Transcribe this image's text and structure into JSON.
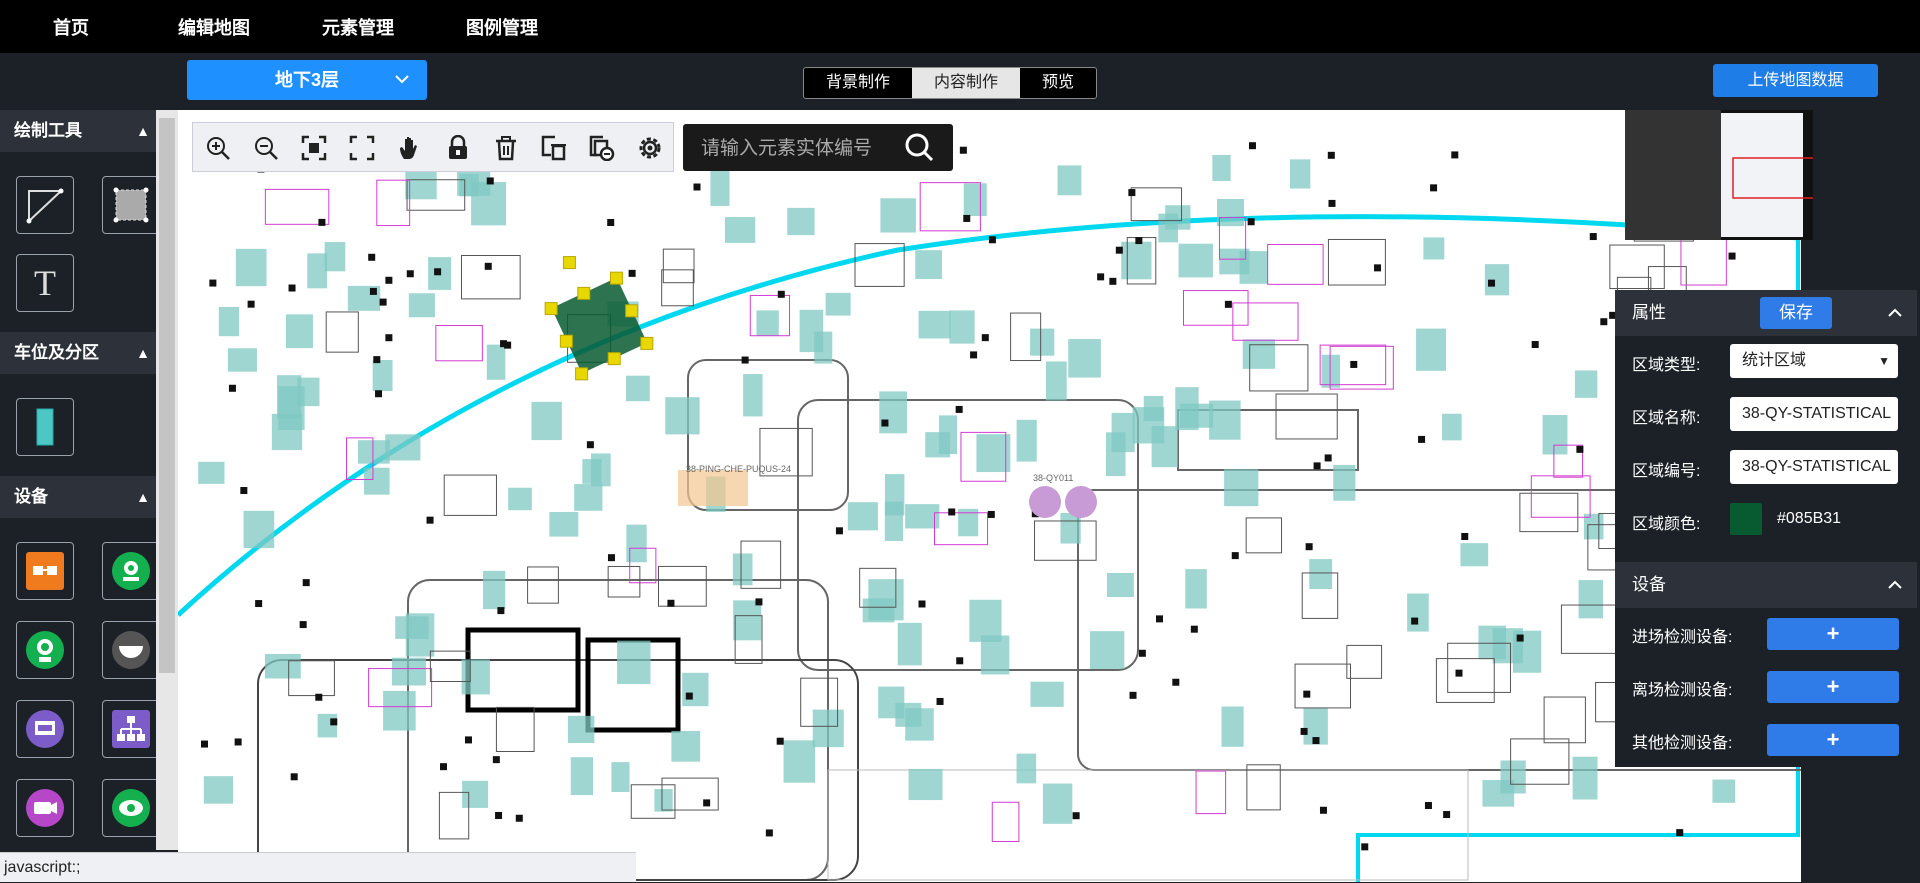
{
  "nav": {
    "items": [
      "首页",
      "编辑地图",
      "元素管理",
      "图例管理"
    ]
  },
  "floor": {
    "selected": "地下3层"
  },
  "modes": {
    "items": [
      "背景制作",
      "内容制作",
      "预览"
    ],
    "active": "内容制作"
  },
  "upload_label": "上传地图数据",
  "sidebar": {
    "draw_tools_title": "绘制工具",
    "parking_title": "车位及分区",
    "devices_title": "设备",
    "text_tool_glyph": "T"
  },
  "toolbar": {
    "icons": [
      "zoom-in-icon",
      "zoom-out-icon",
      "fit-screen-icon",
      "fullscreen-icon",
      "pan-hand-icon",
      "lock-icon",
      "delete-icon",
      "delete-layer-icon",
      "remove-layer-icon",
      "settings-icon"
    ]
  },
  "search": {
    "placeholder": "请输入元素实体编号"
  },
  "properties": {
    "title": "属性",
    "save_label": "保存",
    "area_type_label": "区域类型:",
    "area_type_value": "统计区域",
    "area_name_label": "区域名称:",
    "area_name_value": "38-QY-STATISTICAL",
    "area_code_label": "区域编号:",
    "area_code_value": "38-QY-STATISTICAL",
    "area_color_label": "区域颜色:",
    "area_color_value": "#085B31"
  },
  "devices": {
    "title": "设备",
    "entry_label": "进场检测设备:",
    "exit_label": "离场检测设备:",
    "other_label": "其他检测设备:",
    "plus": "+"
  },
  "map_labels": {
    "label_1": "38-PING-CHE-PUQUS-24",
    "label_2": "38-QY011"
  },
  "status_text": "javascript:;",
  "colors": {
    "accent": "#1e90ff",
    "selected_area": "#085B31",
    "parking": "#7fc8c2",
    "boundary": "#00e5ff"
  }
}
